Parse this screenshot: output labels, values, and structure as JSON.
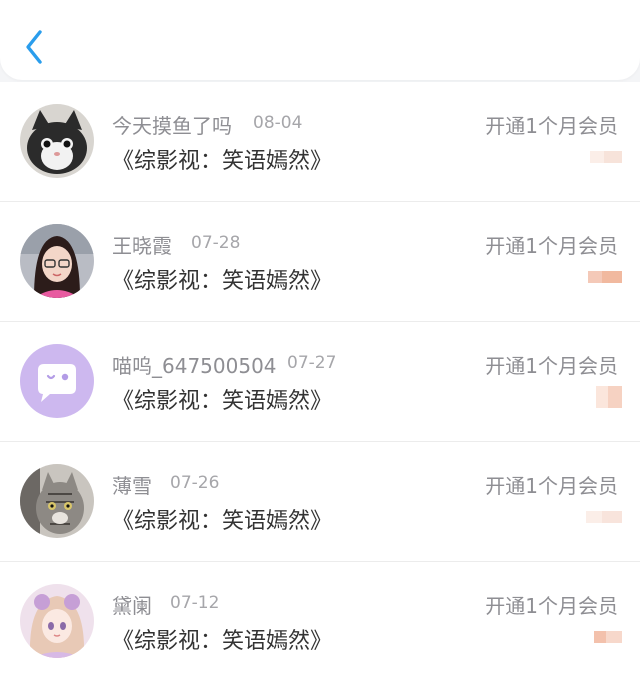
{
  "header": {
    "back_icon": "chevron-left-icon",
    "accent_color": "#2a9dec"
  },
  "records": [
    {
      "username": "今天摸鱼了吗",
      "date": "08-04",
      "title": "《综影视：笑语嫣然》",
      "action": "开通1个月会员",
      "avatar_icon": "cat-avatar-icon"
    },
    {
      "username": "王晓霞",
      "date": "07-28",
      "title": "《综影视：笑语嫣然》",
      "action": "开通1个月会员",
      "avatar_icon": "girl-photo-avatar-icon"
    },
    {
      "username": "喵呜_647500504",
      "date": "07-27",
      "title": "《综影视：笑语嫣然》",
      "action": "开通1个月会员",
      "avatar_icon": "default-chat-bubble-avatar-icon"
    },
    {
      "username": "薄雪",
      "date": "07-26",
      "title": "《综影视：笑语嫣然》",
      "action": "开通1个月会员",
      "avatar_icon": "tabby-cat-avatar-icon"
    },
    {
      "username": "黛阑",
      "date": "07-12",
      "title": "《综影视：笑语嫣然》",
      "action": "开通1个月会员",
      "avatar_icon": "anime-girl-avatar-icon"
    }
  ]
}
